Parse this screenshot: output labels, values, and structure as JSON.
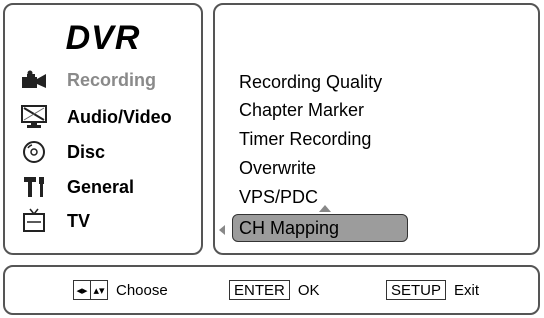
{
  "title": "DVR",
  "sidebar": {
    "items": [
      {
        "label": "Recording",
        "icon": "camera-icon"
      },
      {
        "label": "Audio/Video",
        "icon": "monitor-icon"
      },
      {
        "label": "Disc",
        "icon": "disc-icon"
      },
      {
        "label": "General",
        "icon": "tools-icon"
      },
      {
        "label": "TV",
        "icon": "tv-icon"
      }
    ]
  },
  "submenu": {
    "items": [
      "Recording Quality",
      "Chapter Marker",
      "Timer Recording",
      "Overwrite",
      "VPS/PDC",
      "CH Mapping"
    ],
    "selected": "CH Mapping"
  },
  "footer": {
    "choose_label": "Choose",
    "enter_key": "ENTER",
    "ok_label": "OK",
    "setup_key": "SETUP",
    "exit_label": "Exit"
  }
}
